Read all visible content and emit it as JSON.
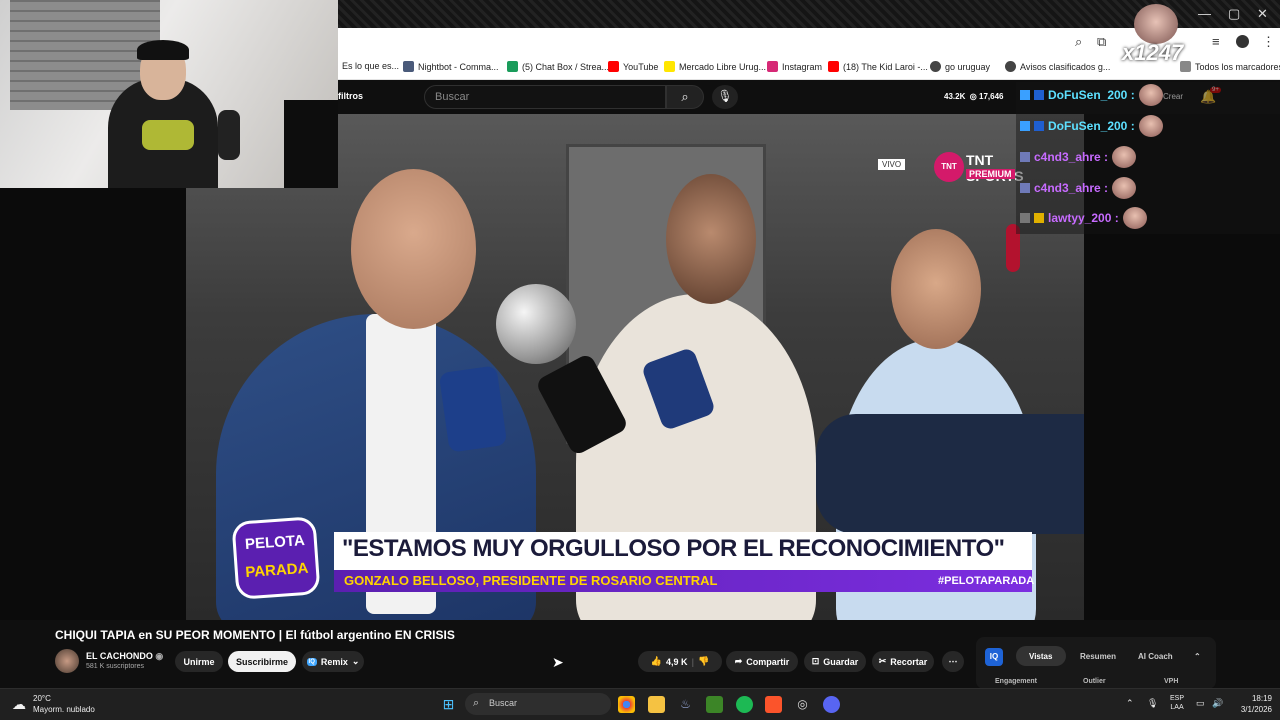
{
  "browser": {
    "bookmarks": [
      "Es lo que es...",
      "Nightbot - Comma...",
      "(5) Chat Box / Strea...",
      "YouTube",
      "Mercado Libre Urug...",
      "Instagram",
      "(18) The Kid Laroi -...",
      "go uruguay",
      "Avisos clasificados g...",
      "Todos los marcadores"
    ],
    "colors": {
      "accent": "#ff0000",
      "brand": "#5b1fb0"
    }
  },
  "yt_header": {
    "filters_label": "filtros",
    "search_placeholder": "Buscar",
    "viewers": "43.2K",
    "views_live": "17,646",
    "create_label": "Crear",
    "notif_count": "9+"
  },
  "overlay": {
    "streamer_tag": "x1247",
    "chat": [
      {
        "user": "DoFuSen_200 :"
      },
      {
        "user": "DoFuSen_200 :"
      },
      {
        "user": "c4nd3_ahre :"
      },
      {
        "user": "c4nd3_ahre :"
      },
      {
        "user": "lawtyy_200 :"
      }
    ]
  },
  "video": {
    "live_tag": "VIVO",
    "broadcaster": "TNT SPORTS",
    "broadcaster_sub": "PREMIUM",
    "headline": "\"ESTAMOS MUY ORGULLOSO POR EL RECONOCIMIENTO\"",
    "subline": "GONZALO BELLOSO, PRESIDENTE DE ROSARIO CENTRAL",
    "hashtag": "#PELOTAPARADA",
    "logo_top": "PELOTA",
    "logo_bottom": "PARADA"
  },
  "meta": {
    "title": "CHIQUI TAPIA en SU PEOR MOMENTO | El fútbol argentino EN CRISIS",
    "channel": "EL CACHONDO",
    "subscribers": "581 K suscriptores",
    "join_label": "Unirme",
    "subscribe_label": "Suscribirme",
    "remix_label": "Remix",
    "likes": "4,9 K",
    "share_label": "Compartir",
    "save_label": "Guardar",
    "clip_label": "Recortar"
  },
  "side_panel": {
    "badge": "IQ",
    "tabs": [
      "Vistas",
      "Resumen",
      "AI Coach"
    ],
    "subs": [
      "Engagement",
      "Outlier",
      "VPH"
    ]
  },
  "taskbar": {
    "temp": "20°C",
    "weather": "Mayorm. nublado",
    "search": "Buscar",
    "lang_top": "ESP",
    "lang_bottom": "LAA",
    "time": "18:19",
    "date": "3/1/2026"
  }
}
